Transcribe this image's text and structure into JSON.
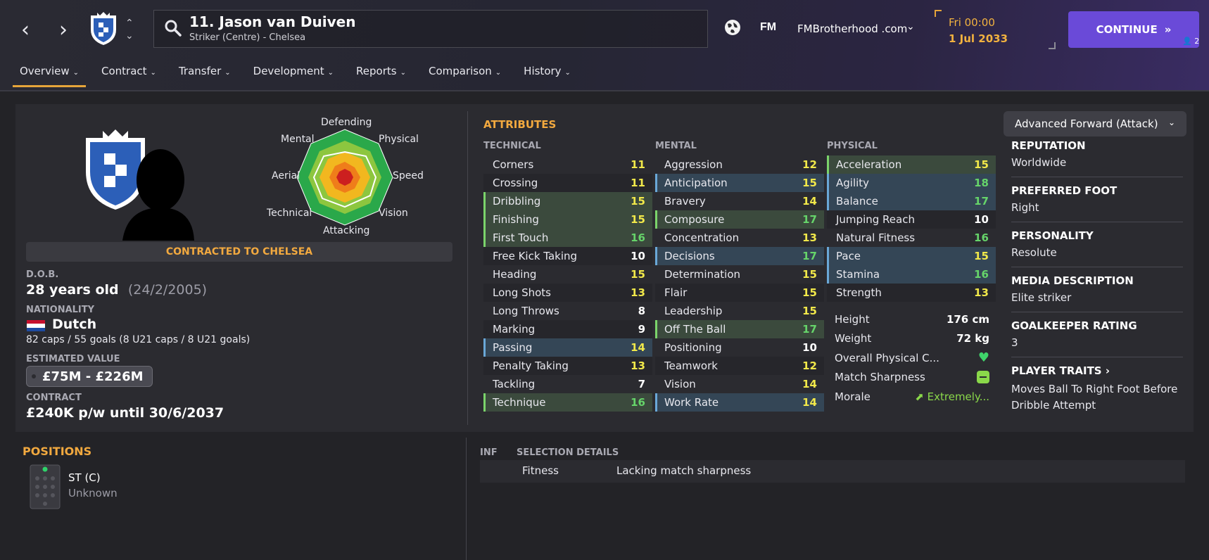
{
  "header": {
    "player_title": "11. Jason van Duiven",
    "player_subtitle": "Striker (Centre) - Chelsea",
    "brand_logo": "FM",
    "brand_name": "FMBrotherhood .com",
    "date_day": "Fri 00:00",
    "date": "1 Jul 2033",
    "continue_label": "CONTINUE",
    "continue_badge": "2"
  },
  "tabs": [
    {
      "label": "Overview",
      "active": true
    },
    {
      "label": "Contract"
    },
    {
      "label": "Transfer"
    },
    {
      "label": "Development"
    },
    {
      "label": "Reports"
    },
    {
      "label": "Comparison"
    },
    {
      "label": "History"
    }
  ],
  "profile": {
    "contracted": "CONTRACTED TO CHELSEA",
    "dob_label": "D.O.B.",
    "age": "28 years old",
    "dob": "(24/2/2005)",
    "nationality_label": "NATIONALITY",
    "nationality": "Dutch",
    "caps": "82 caps / 55 goals (8 U21 caps / 8 U21 goals)",
    "value_label": "ESTIMATED VALUE",
    "value": "£75M - £226M",
    "contract_label": "CONTRACT",
    "contract": "£240K p/w until 30/6/2037"
  },
  "radar": {
    "labels": {
      "defending": "Defending",
      "physical": "Physical",
      "speed": "Speed",
      "vision": "Vision",
      "attacking": "Attacking",
      "technical": "Technical",
      "aerial": "Aerial",
      "mental": "Mental"
    }
  },
  "attributes": {
    "title": "ATTRIBUTES",
    "technical_head": "TECHNICAL",
    "mental_head": "MENTAL",
    "physical_head": "PHYSICAL",
    "technical": [
      {
        "name": "Corners",
        "value": "11",
        "tone": "yellow",
        "hl": ""
      },
      {
        "name": "Crossing",
        "value": "11",
        "tone": "yellow",
        "hl": ""
      },
      {
        "name": "Dribbling",
        "value": "15",
        "tone": "yellow",
        "hl": "green"
      },
      {
        "name": "Finishing",
        "value": "15",
        "tone": "yellow",
        "hl": "green"
      },
      {
        "name": "First Touch",
        "value": "16",
        "tone": "green",
        "hl": "green"
      },
      {
        "name": "Free Kick Taking",
        "value": "10",
        "tone": "white",
        "hl": ""
      },
      {
        "name": "Heading",
        "value": "15",
        "tone": "yellow",
        "hl": ""
      },
      {
        "name": "Long Shots",
        "value": "13",
        "tone": "yellow",
        "hl": ""
      },
      {
        "name": "Long Throws",
        "value": "8",
        "tone": "white",
        "hl": ""
      },
      {
        "name": "Marking",
        "value": "9",
        "tone": "white",
        "hl": ""
      },
      {
        "name": "Passing",
        "value": "14",
        "tone": "yellow",
        "hl": "blue"
      },
      {
        "name": "Penalty Taking",
        "value": "13",
        "tone": "yellow",
        "hl": ""
      },
      {
        "name": "Tackling",
        "value": "7",
        "tone": "white",
        "hl": ""
      },
      {
        "name": "Technique",
        "value": "16",
        "tone": "green",
        "hl": "green"
      }
    ],
    "mental": [
      {
        "name": "Aggression",
        "value": "12",
        "tone": "yellow",
        "hl": ""
      },
      {
        "name": "Anticipation",
        "value": "15",
        "tone": "yellow",
        "hl": "blue"
      },
      {
        "name": "Bravery",
        "value": "14",
        "tone": "yellow",
        "hl": ""
      },
      {
        "name": "Composure",
        "value": "17",
        "tone": "green",
        "hl": "green"
      },
      {
        "name": "Concentration",
        "value": "13",
        "tone": "yellow",
        "hl": ""
      },
      {
        "name": "Decisions",
        "value": "17",
        "tone": "green",
        "hl": "blue"
      },
      {
        "name": "Determination",
        "value": "15",
        "tone": "yellow",
        "hl": ""
      },
      {
        "name": "Flair",
        "value": "15",
        "tone": "yellow",
        "hl": ""
      },
      {
        "name": "Leadership",
        "value": "15",
        "tone": "yellow",
        "hl": ""
      },
      {
        "name": "Off The Ball",
        "value": "17",
        "tone": "green",
        "hl": "green"
      },
      {
        "name": "Positioning",
        "value": "10",
        "tone": "white",
        "hl": ""
      },
      {
        "name": "Teamwork",
        "value": "12",
        "tone": "yellow",
        "hl": ""
      },
      {
        "name": "Vision",
        "value": "14",
        "tone": "yellow",
        "hl": ""
      },
      {
        "name": "Work Rate",
        "value": "14",
        "tone": "yellow",
        "hl": "blue"
      }
    ],
    "physical": [
      {
        "name": "Acceleration",
        "value": "15",
        "tone": "yellow",
        "hl": "green"
      },
      {
        "name": "Agility",
        "value": "18",
        "tone": "green",
        "hl": "blue"
      },
      {
        "name": "Balance",
        "value": "17",
        "tone": "green",
        "hl": "blue"
      },
      {
        "name": "Jumping Reach",
        "value": "10",
        "tone": "white",
        "hl": ""
      },
      {
        "name": "Natural Fitness",
        "value": "16",
        "tone": "green",
        "hl": ""
      },
      {
        "name": "Pace",
        "value": "15",
        "tone": "yellow",
        "hl": "blue"
      },
      {
        "name": "Stamina",
        "value": "16",
        "tone": "green",
        "hl": "blue"
      },
      {
        "name": "Strength",
        "value": "13",
        "tone": "yellow",
        "hl": ""
      }
    ],
    "height_label": "Height",
    "height": "176 cm",
    "weight_label": "Weight",
    "weight": "72 kg",
    "condition_label": "Overall Physical C...",
    "sharpness_label": "Match Sharpness",
    "morale_label": "Morale",
    "morale": "Extremely..."
  },
  "info": {
    "role": "Advanced Forward (Attack)",
    "reputation_label": "REPUTATION",
    "reputation": "Worldwide",
    "foot_label": "PREFERRED FOOT",
    "foot": "Right",
    "personality_label": "PERSONALITY",
    "personality": "Resolute",
    "media_label": "MEDIA DESCRIPTION",
    "media": "Elite striker",
    "gk_label": "GOALKEEPER RATING",
    "gk": "3",
    "traits_label": "PLAYER TRAITS",
    "traits": "Moves Ball To Right Foot Before Dribble Attempt"
  },
  "positions": {
    "title": "POSITIONS",
    "name": "ST (C)",
    "level": "Unknown"
  },
  "selection": {
    "inf_head": "INF",
    "details_head": "SELECTION DETAILS",
    "item": "Fitness",
    "detail": "Lacking match sharpness"
  },
  "colors": {
    "accent": "#f2a93f",
    "continue": "#6a4ad8",
    "green_value": "#66d46a",
    "yellow_value": "#f1e84a"
  }
}
